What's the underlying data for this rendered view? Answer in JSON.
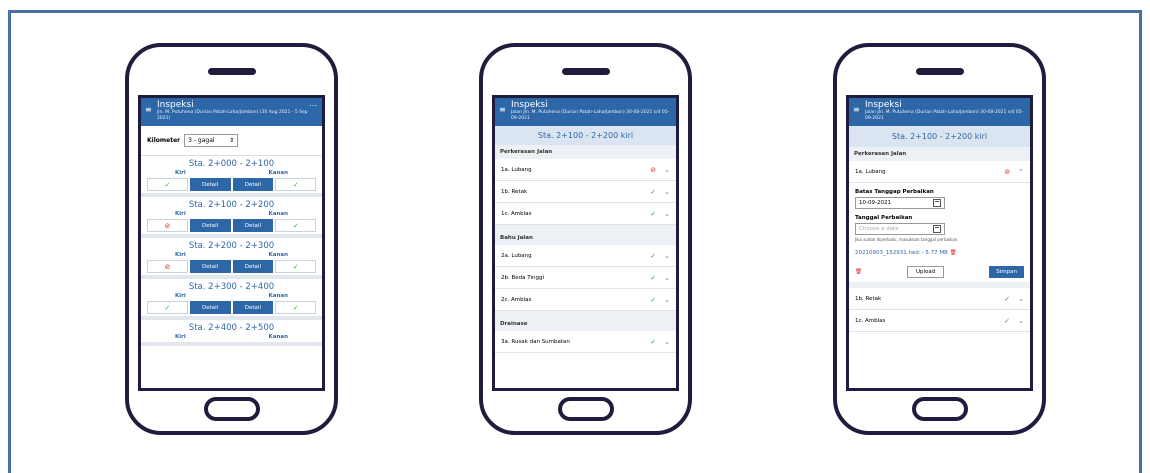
{
  "phone1": {
    "app_title": "Inspeksi",
    "app_subtitle": "Jln. M. Putuhena (Durian Patah-Laha/Jambon) (30 Aug 2021 - 5 Sep 2021)",
    "km_label": "Kilometer",
    "km_value": "3 - gagal",
    "left_label": "Kiri",
    "right_label": "Kanan",
    "detail_label": "Detail",
    "stations": [
      {
        "title": "Sta. 2+000 - 2+100",
        "left": "ok",
        "right": "ok"
      },
      {
        "title": "Sta. 2+100 - 2+200",
        "left": "bad",
        "right": "ok"
      },
      {
        "title": "Sta. 2+200 - 2+300",
        "left": "bad",
        "right": "ok"
      },
      {
        "title": "Sta. 2+300 - 2+400",
        "left": "ok",
        "right": "ok"
      },
      {
        "title": "Sta. 2+400 - 2+500",
        "left": "",
        "right": ""
      }
    ]
  },
  "phone2": {
    "app_title": "Inspeksi",
    "app_subtitle": "Jalan Jln. M. Putuhena (Durian Patah-Laha/Jambon) 30-08-2021 s/d 05-09-2021",
    "section_title": "Sta. 2+100 - 2+200 kiri",
    "groups": [
      {
        "name": "Perkerasan Jalan",
        "items": [
          {
            "label": "1a. Lubang",
            "status": "bad"
          },
          {
            "label": "1b. Retak",
            "status": "ok"
          },
          {
            "label": "1c. Amblas",
            "status": "ok"
          }
        ]
      },
      {
        "name": "Bahu Jalan",
        "items": [
          {
            "label": "2a. Lubang",
            "status": "ok"
          },
          {
            "label": "2b. Beda Tinggi",
            "status": "ok"
          },
          {
            "label": "2c. Amblas",
            "status": "ok"
          }
        ]
      },
      {
        "name": "Drainase",
        "items": [
          {
            "label": "3a. Rusak dan Sumbatan",
            "status": "ok"
          }
        ]
      }
    ]
  },
  "phone3": {
    "app_title": "Inspeksi",
    "app_subtitle": "Jalan Jln. M. Putuhena (Durian Patah-Laha/Jambon) 30-08-2021 s/d 05-09-2021",
    "section_title": "Sta. 2+100 - 2+200 kiri",
    "group_name": "Perkerasan Jalan",
    "expanded_item": "1a. Lubang",
    "deadline_label": "Batas Tanggap Perbaikan",
    "deadline_value": "10-09-2021",
    "repair_label": "Tanggal Perbaikan",
    "repair_placeholder": "Choose a date",
    "repair_hint": "Jika sudah diperbaiki, masukkan tanggal perbaikan.",
    "file_name": "20210903_152931.heic - 5.77 MB",
    "upload_label": "Upload",
    "save_label": "Simpan",
    "other_items": [
      {
        "label": "1b. Retak",
        "status": "ok"
      },
      {
        "label": "1c. Amblas",
        "status": "ok"
      }
    ]
  },
  "icons": {
    "ok": "✓",
    "bad": "⊘",
    "chevron_down": "⌄",
    "chevron_up": "⌃",
    "trash": "🗑",
    "menu": "≡",
    "more": "⋯"
  },
  "colors": {
    "frame": "#4a6fa5",
    "phone": "#1f1d3d",
    "primary": "#2e67a8",
    "ok": "#3aa63a",
    "bad": "#dd2222"
  }
}
